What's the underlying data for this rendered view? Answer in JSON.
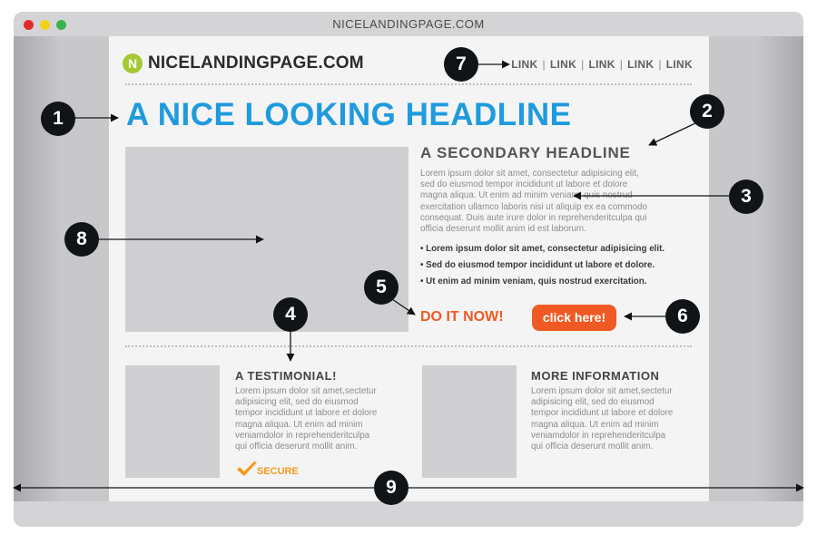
{
  "window": {
    "title": "NICELANDINGPAGE.COM"
  },
  "header": {
    "logo_letter": "N",
    "logo_text": "NICELANDINGPAGE.COM",
    "nav_links": [
      "LINK",
      "LINK",
      "LINK",
      "LINK",
      "LINK"
    ],
    "nav_separator": "|"
  },
  "main": {
    "headline": "A NICE LOOKING HEADLINE",
    "secondary_headline": "A SECONDARY HEADLINE",
    "body_lines": [
      "Lorem ipsum dolor sit amet, consectetur adipisicing elit,",
      "sed do eiusmod tempor incididunt ut labore et dolore",
      "magna aliqua. Ut enim ad minim veniam, quis nostrud",
      "exercitation ullamco laboris nisi ut aliquip ex ea commodo",
      "consequat. Duis aute irure dolor in reprehenderitculpa qui",
      "officia deserunt mollit anim id est laborum."
    ],
    "bullets": [
      "Lorem ipsum dolor sit amet, consectetur adipisicing elit.",
      "Sed do eiusmod tempor incididunt ut labore et dolore.",
      "Ut enim ad minim veniam, quis nostrud exercitation."
    ],
    "cta_text": "DO IT NOW!",
    "cta_button": "click here!"
  },
  "testimonial": {
    "title": "A TESTIMONIAL!",
    "lines": [
      "Lorem ipsum dolor sit amet,sectetur",
      "adipisicing elit, sed do eiusmod",
      "tempor incididunt ut labore et dolore",
      "magna aliqua. Ut enim ad minim",
      "veniamdolor in reprehenderitculpa",
      "qui officia deserunt mollit anim."
    ],
    "secure_label": "SECURE"
  },
  "more_info": {
    "title": "MORE INFORMATION",
    "lines": [
      "Lorem ipsum dolor sit amet,sectetur",
      "adipisicing elit, sed do eiusmod",
      "tempor incididunt ut labore et dolore",
      "magna aliqua. Ut enim ad minim",
      "veniamdolor in reprehenderitculpa",
      "qui officia deserunt mollit anim."
    ]
  },
  "callouts": [
    "1",
    "2",
    "3",
    "4",
    "5",
    "6",
    "7",
    "8",
    "9"
  ],
  "colors": {
    "headline_blue": "#1f9bdd",
    "cta_orange": "#ef5a24",
    "logo_green": "#a6c833",
    "secure_orange": "#f39a1e",
    "badge_dark": "#111417"
  },
  "icons": {
    "logo": "logo-circle-icon",
    "secure": "checkmark-icon"
  }
}
